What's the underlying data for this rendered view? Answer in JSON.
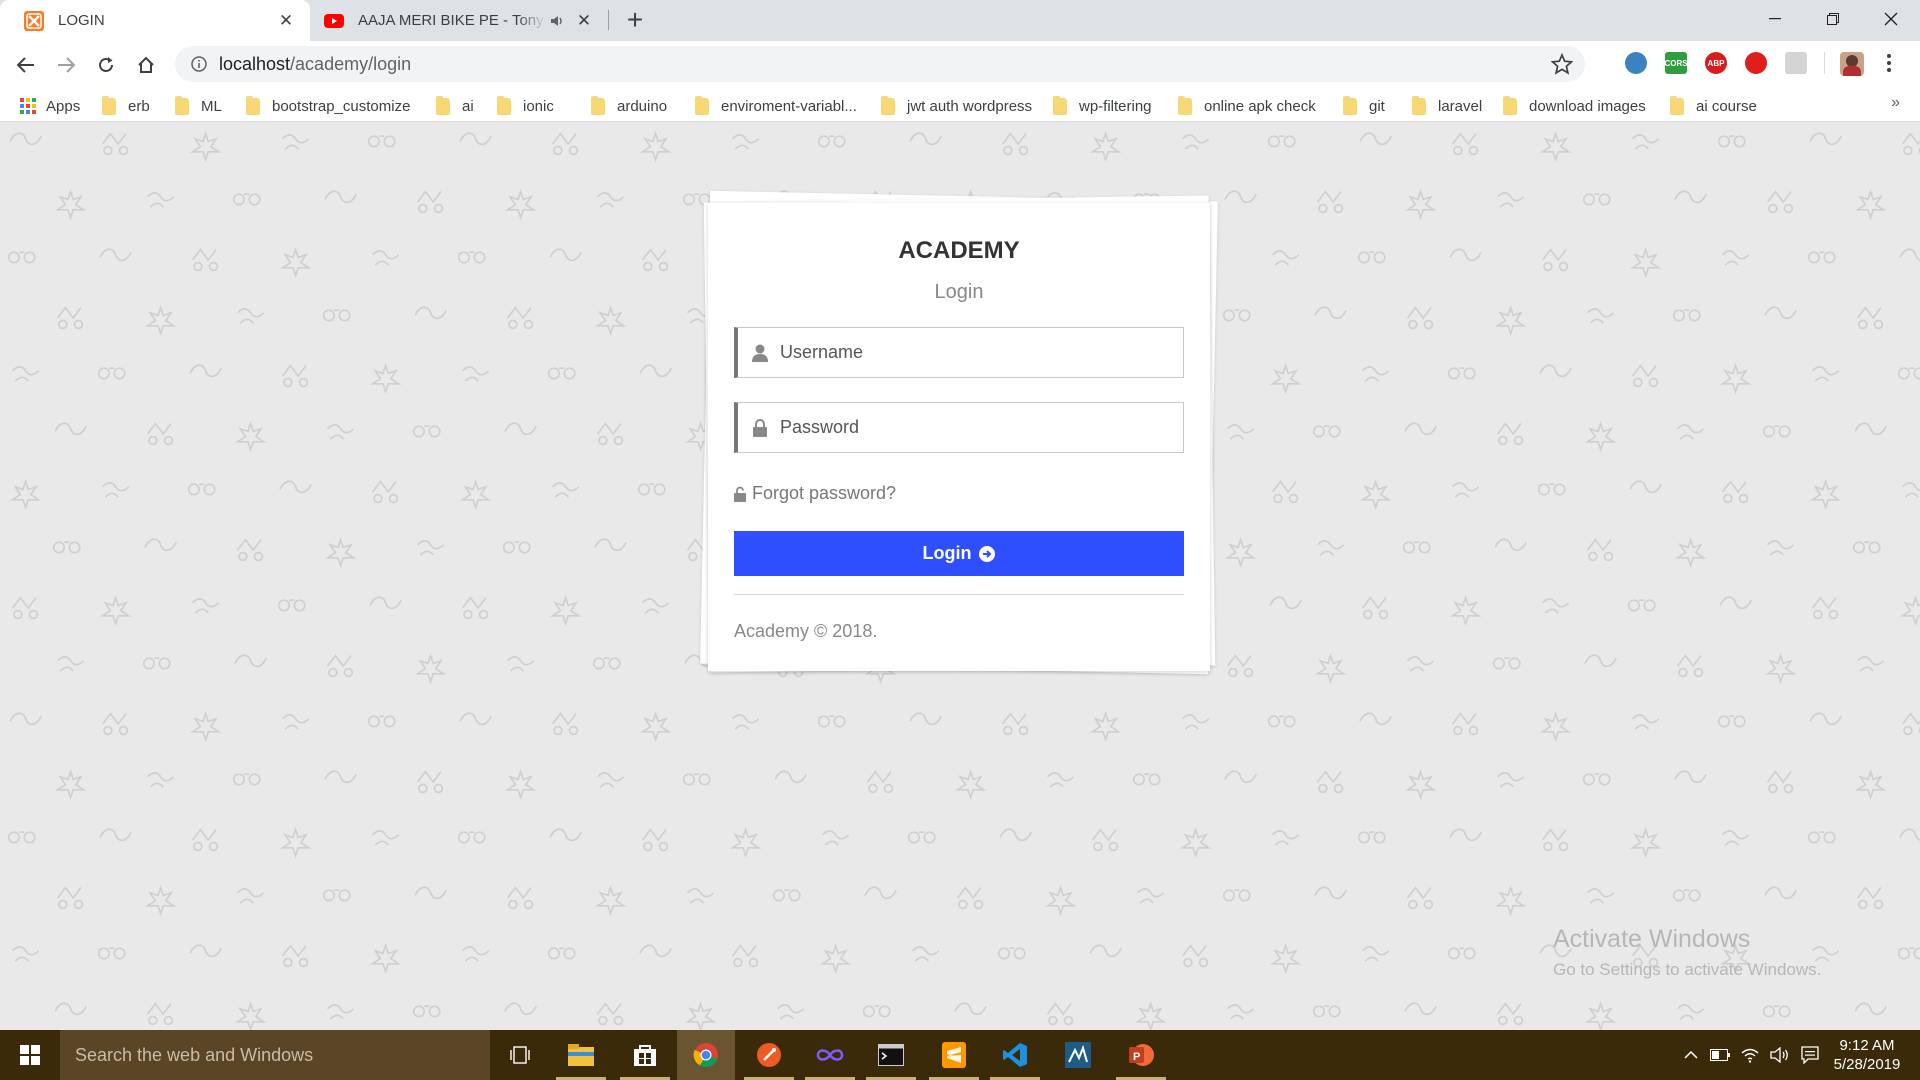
{
  "browser": {
    "tabs": [
      {
        "title": "LOGIN",
        "active": true
      },
      {
        "title": "AAJA MERI BIKE PE - Tony Ka",
        "active": false
      }
    ],
    "url": {
      "host": "localhost",
      "path": "/academy/login"
    },
    "bookmarks": [
      {
        "label": "Apps"
      },
      {
        "label": "erb"
      },
      {
        "label": "ML"
      },
      {
        "label": "bootstrap_customize"
      },
      {
        "label": "ai"
      },
      {
        "label": "ionic"
      },
      {
        "label": "arduino"
      },
      {
        "label": "enviroment-variabl..."
      },
      {
        "label": "jwt auth wordpress"
      },
      {
        "label": "wp-filtering"
      },
      {
        "label": "online apk check"
      },
      {
        "label": "git"
      },
      {
        "label": "laravel"
      },
      {
        "label": "download images"
      },
      {
        "label": "ai course"
      }
    ],
    "extensions": [
      {
        "icon": "blue-circle-extension-icon",
        "color": "#3b82c4",
        "text": ""
      },
      {
        "icon": "cors-extension-icon",
        "color": "#2e9e3e",
        "text": "CORS"
      },
      {
        "icon": "adblock-plus-icon",
        "color": "#d81b1b",
        "text": "ABP"
      },
      {
        "icon": "adblock-icon",
        "color": "#e01d1d",
        "text": ""
      },
      {
        "icon": "grey-extension-icon",
        "color": "#d4d4d4",
        "text": ""
      }
    ]
  },
  "login": {
    "brand": "ACADEMY",
    "subtitle": "Login",
    "username_placeholder": "Username",
    "password_placeholder": "Password",
    "forgot": "Forgot password?",
    "button": "Login",
    "footer": "Academy © 2018.",
    "button_color": "#2e4fff"
  },
  "watermark": {
    "title": "Activate Windows",
    "subtitle": "Go to Settings to activate Windows."
  },
  "taskbar": {
    "search_placeholder": "Search the web and Windows",
    "time": "9:12 AM",
    "date": "5/28/2019",
    "apps": [
      {
        "icon": "task-view-icon"
      },
      {
        "icon": "file-explorer-icon"
      },
      {
        "icon": "store-icon"
      },
      {
        "icon": "chrome-icon",
        "active": true
      },
      {
        "icon": "postman-icon"
      },
      {
        "icon": "infinity-app-icon"
      },
      {
        "icon": "terminal-icon"
      },
      {
        "icon": "sublime-text-icon"
      },
      {
        "icon": "vscode-icon"
      },
      {
        "icon": "mysql-workbench-icon"
      },
      {
        "icon": "powerpoint-icon"
      }
    ]
  }
}
